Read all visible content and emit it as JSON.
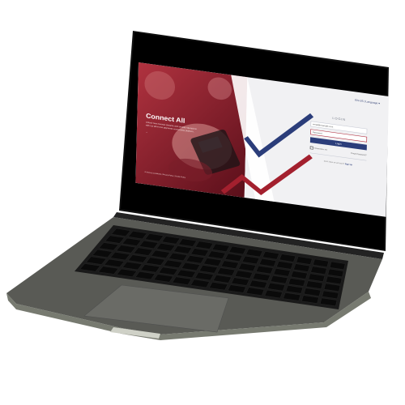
{
  "colors": {
    "hero_red": "#8a2330",
    "checkmark_navy": "#2b3d7a",
    "checkmark_red": "#a3202e",
    "laptop_body": "#4a4b46"
  },
  "hero": {
    "title": "Connect All",
    "subtitle_line1": "Unlock new revenue streams and simplify operations",
    "subtitle_line2": "with our all-in-one payments connectivity platform.",
    "link": "→",
    "footer": "© Terms & Conditions | Privacy Policy | Cookie Policy"
  },
  "header": {
    "language": "EN-US | Language ▾"
  },
  "login": {
    "title": "LOGIN",
    "email_value": "email@example.com",
    "password_value": "Password",
    "submit_label": "Login",
    "remember_label": "Remember me",
    "forgot_label": "Forgot Password?",
    "signup_prompt": "Don't have an account?",
    "signup_link": "Sign Up"
  }
}
